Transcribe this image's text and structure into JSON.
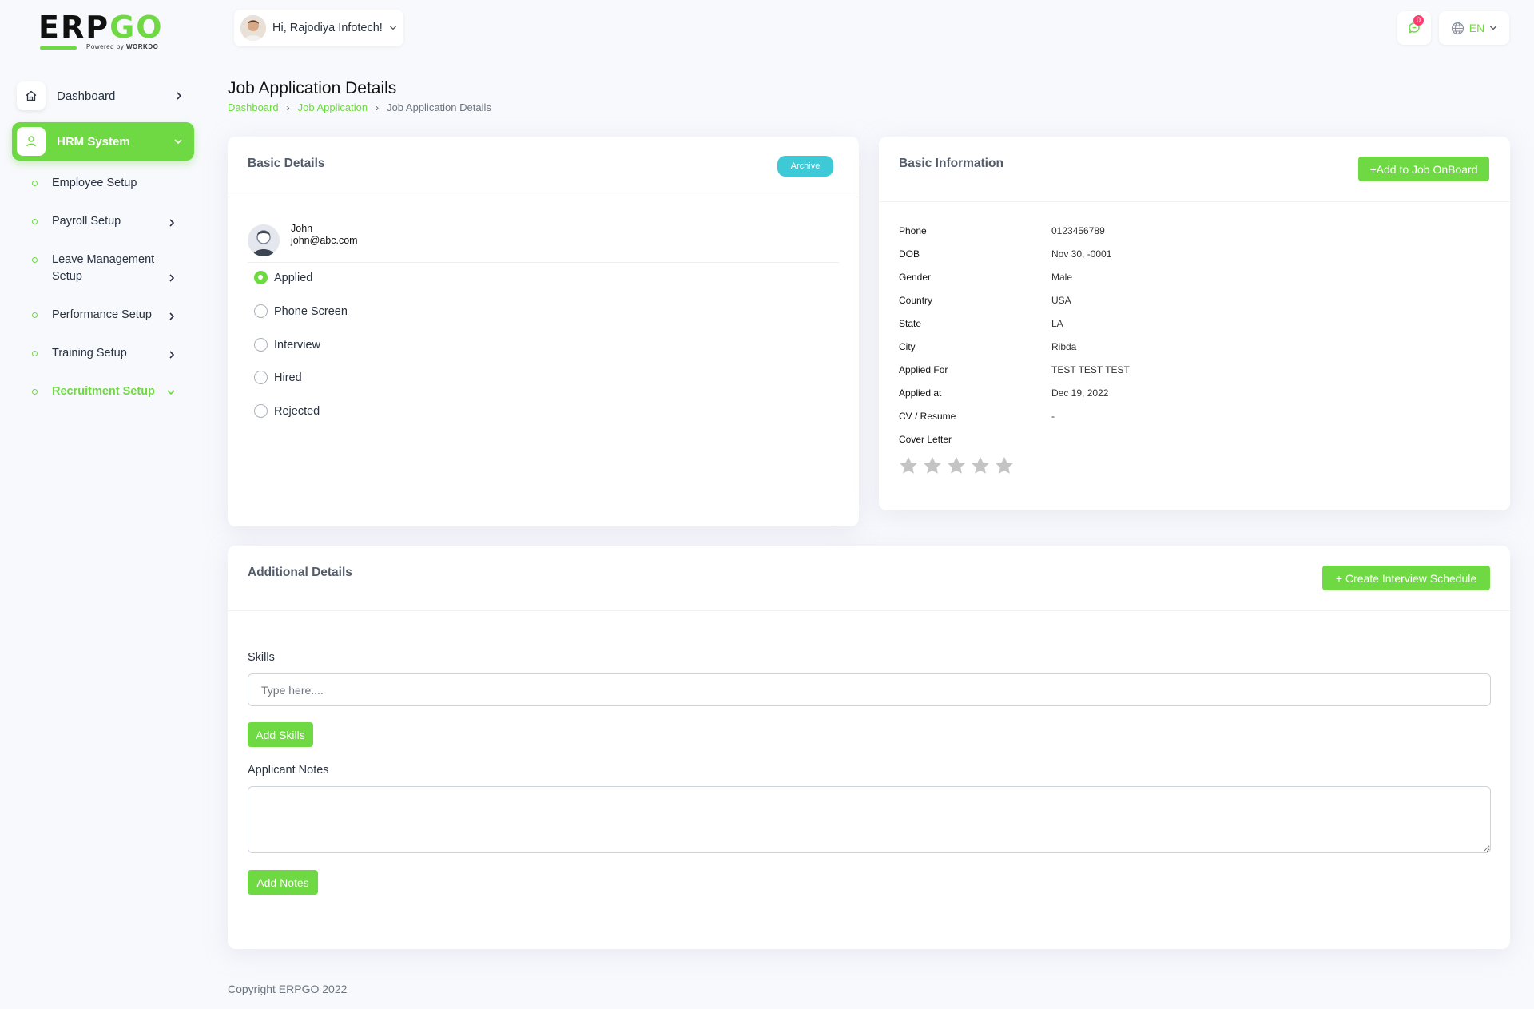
{
  "brand": {
    "logo_main": "ERP",
    "logo_accent": "GO",
    "powered_by": "Powered by",
    "powered_brand": "WORKDO"
  },
  "header": {
    "greeting": "Hi, Rajodiya Infotech!",
    "notification_count": "0",
    "language": "EN"
  },
  "sidebar": {
    "dashboard": "Dashboard",
    "hrm": "HRM System",
    "items": [
      {
        "label": "Employee Setup",
        "has_chevron": false
      },
      {
        "label": "Payroll Setup",
        "has_chevron": true
      },
      {
        "label": "Leave Management Setup",
        "has_chevron": true
      },
      {
        "label": "Performance Setup",
        "has_chevron": true
      },
      {
        "label": "Training Setup",
        "has_chevron": true
      },
      {
        "label": "Recruitment Setup",
        "has_chevron": true,
        "active": true
      }
    ]
  },
  "page": {
    "title": "Job Application Details",
    "breadcrumb": [
      "Dashboard",
      "Job Application",
      "Job Application Details"
    ]
  },
  "basic_details": {
    "title": "Basic Details",
    "archive_label": "Archive",
    "applicant_name": "John",
    "applicant_email": "john@abc.com",
    "stages": [
      {
        "label": "Applied",
        "checked": true
      },
      {
        "label": "Phone Screen",
        "checked": false
      },
      {
        "label": "Interview",
        "checked": false
      },
      {
        "label": "Hired",
        "checked": false
      },
      {
        "label": "Rejected",
        "checked": false
      }
    ]
  },
  "basic_information": {
    "title": "Basic Information",
    "onboard_label": "+Add to Job OnBoard",
    "fields": [
      {
        "label": "Phone",
        "value": "0123456789"
      },
      {
        "label": "DOB",
        "value": "Nov 30, -0001"
      },
      {
        "label": "Gender",
        "value": "Male"
      },
      {
        "label": "Country",
        "value": "USA"
      },
      {
        "label": "State",
        "value": "LA"
      },
      {
        "label": "City",
        "value": "Ribda"
      },
      {
        "label": "Applied For",
        "value": "TEST TEST TEST"
      },
      {
        "label": "Applied at",
        "value": "Dec 19, 2022"
      },
      {
        "label": "CV / Resume",
        "value": "-"
      },
      {
        "label": "Cover Letter",
        "value": ""
      }
    ],
    "rating": 0,
    "rating_max": 5,
    "star_color": "#c4c4c4"
  },
  "additional_details": {
    "title": "Additional Details",
    "interview_label": "+ Create Interview Schedule",
    "skills_label": "Skills",
    "skills_placeholder": "Type here....",
    "add_skills_label": "Add Skills",
    "notes_label": "Applicant Notes",
    "add_notes_label": "Add Notes"
  },
  "footer": {
    "copyright": "Copyright ERPGO 2022"
  },
  "colors": {
    "accent": "#6fd943",
    "archive": "#3ec9d6",
    "badge": "#ff3a6e"
  }
}
